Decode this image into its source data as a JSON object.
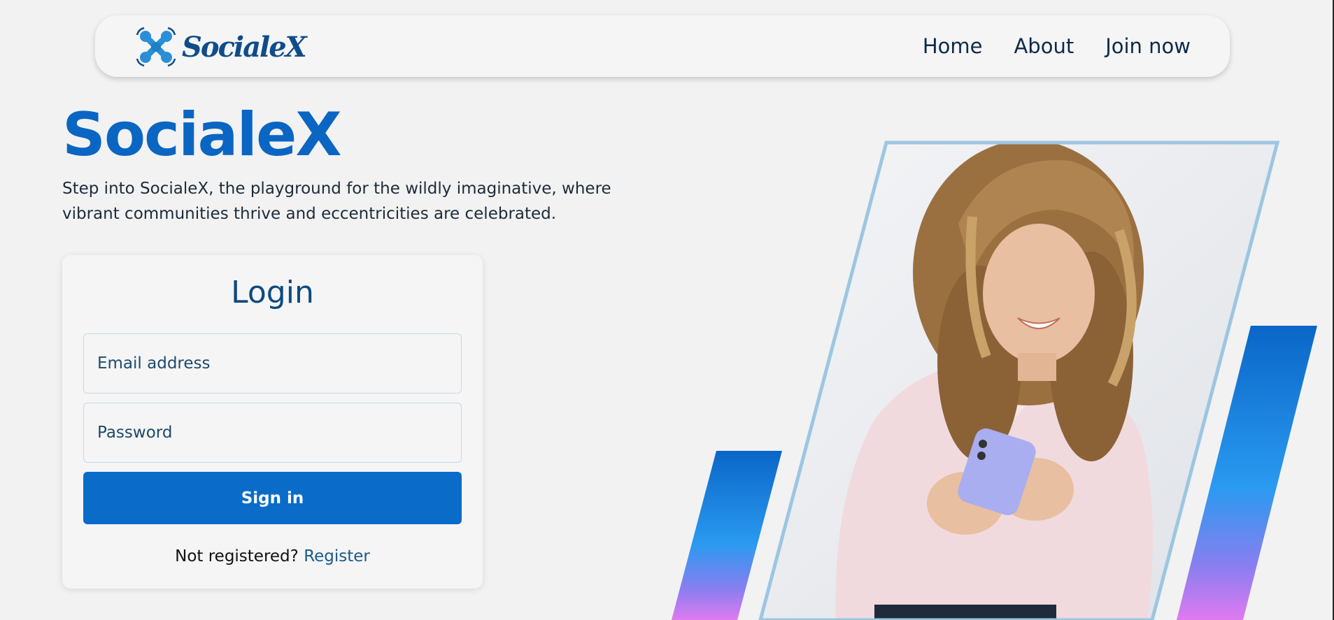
{
  "nav": {
    "logo_text": "SocialeX",
    "links": [
      "Home",
      "About",
      "Join now"
    ]
  },
  "hero": {
    "title": "SocialeX",
    "description": "Step into SocialeX, the playground for the wildly imaginative, where vibrant communities thrive and eccentricities are celebrated."
  },
  "login": {
    "title": "Login",
    "email_placeholder": "Email address",
    "password_placeholder": "Password",
    "submit_label": "Sign in",
    "register_prompt": "Not registered?",
    "register_link": "Register"
  },
  "colors": {
    "brand": "#0a66c2",
    "button": "#0a6cc8",
    "frame": "#9cc6e2"
  },
  "icons": {
    "logo": "drone-icon"
  }
}
